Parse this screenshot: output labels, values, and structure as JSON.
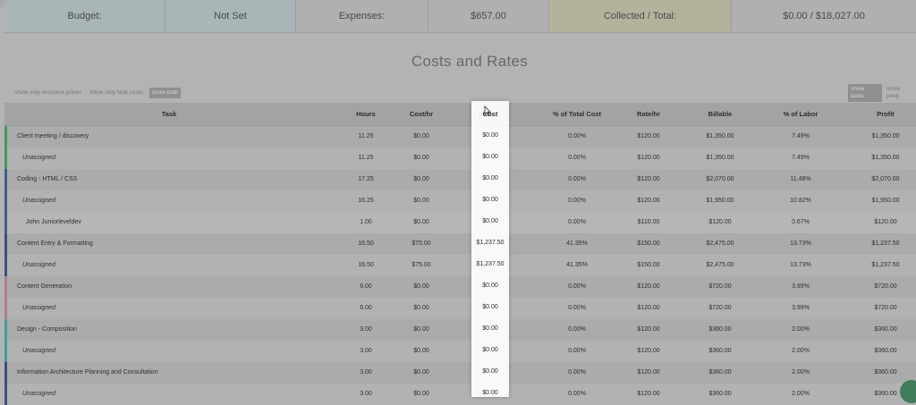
{
  "summary": {
    "budget_label": "Budget:",
    "budget_value": "Not Set",
    "expenses_label": "Expenses:",
    "expenses_value": "$657.00",
    "collected_label": "Collected / Total:",
    "collected_value": "$0.00 / $18,027.00"
  },
  "section_title": "Costs and Rates",
  "filters": {
    "resource_prices": "show only resource prices",
    "task_costs": "show only task costs",
    "both": "show both",
    "tasks": "show tasks",
    "people": "show peop"
  },
  "columns": {
    "task": "Task",
    "hours": "Hours",
    "cost_hr": "Cost/hr",
    "cost": "Cost",
    "pct_total_cost": "% of Total Cost",
    "rate_hr": "Rate/hr",
    "billable": "Billable",
    "pct_labor": "% of Labor",
    "profit": "Profit"
  },
  "rows": [
    {
      "task": "Client meeting / discovery",
      "hours": "11.25",
      "cost_hr": "$0.00",
      "cost": "$0.00",
      "pct_total_cost": "0.00%",
      "rate_hr": "$120.00",
      "billable": "$1,350.00",
      "pct_labor": "7.49%",
      "profit": "$1,350.00"
    },
    {
      "task": "Unassigned",
      "hours": "11.25",
      "cost_hr": "$0.00",
      "cost": "$0.00",
      "pct_total_cost": "0.00%",
      "rate_hr": "$120.00",
      "billable": "$1,350.00",
      "pct_labor": "7.49%",
      "profit": "$1,350.00"
    },
    {
      "task": "Coding - HTML / CSS",
      "hours": "17.25",
      "cost_hr": "$0.00",
      "cost": "$0.00",
      "pct_total_cost": "0.00%",
      "rate_hr": "$120.00",
      "billable": "$2,070.00",
      "pct_labor": "11.48%",
      "profit": "$2,070.00"
    },
    {
      "task": "Unassigned",
      "hours": "16.25",
      "cost_hr": "$0.00",
      "cost": "$0.00",
      "pct_total_cost": "0.00%",
      "rate_hr": "$120.00",
      "billable": "$1,950.00",
      "pct_labor": "10.82%",
      "profit": "$1,950.00"
    },
    {
      "task": "John Juniorleveldev",
      "hours": "1.00",
      "cost_hr": "$0.00",
      "cost": "$0.00",
      "pct_total_cost": "0.00%",
      "rate_hr": "$110.00",
      "billable": "$120.00",
      "pct_labor": "0.67%",
      "profit": "$120.00"
    },
    {
      "task": "Content Entry & Formatting",
      "hours": "16.50",
      "cost_hr": "$75.00",
      "cost": "$1,237.50",
      "pct_total_cost": "41.35%",
      "rate_hr": "$150.00",
      "billable": "$2,475.00",
      "pct_labor": "13.73%",
      "profit": "$1,237.50"
    },
    {
      "task": "Unassigned",
      "hours": "16.50",
      "cost_hr": "$75.00",
      "cost": "$1,237.50",
      "pct_total_cost": "41.35%",
      "rate_hr": "$150.00",
      "billable": "$2,475.00",
      "pct_labor": "13.73%",
      "profit": "$1,237.50"
    },
    {
      "task": "Content Generation",
      "hours": "6.00",
      "cost_hr": "$0.00",
      "cost": "$0.00",
      "pct_total_cost": "0.00%",
      "rate_hr": "$120.00",
      "billable": "$720.00",
      "pct_labor": "3.99%",
      "profit": "$720.00"
    },
    {
      "task": "Unassigned",
      "hours": "6.00",
      "cost_hr": "$0.00",
      "cost": "$0.00",
      "pct_total_cost": "0.00%",
      "rate_hr": "$120.00",
      "billable": "$720.00",
      "pct_labor": "3.99%",
      "profit": "$720.00"
    },
    {
      "task": "Design - Composition",
      "hours": "3.00",
      "cost_hr": "$0.00",
      "cost": "$0.00",
      "pct_total_cost": "0.00%",
      "rate_hr": "$120.00",
      "billable": "$360.00",
      "pct_labor": "2.00%",
      "profit": "$360.00"
    },
    {
      "task": "Unassigned",
      "hours": "3.00",
      "cost_hr": "$0.00",
      "cost": "$0.00",
      "pct_total_cost": "0.00%",
      "rate_hr": "$120.00",
      "billable": "$360.00",
      "pct_labor": "2.00%",
      "profit": "$360.00"
    },
    {
      "task": "Information Architecture Planning and Consultation",
      "hours": "3.00",
      "cost_hr": "$0.00",
      "cost": "$0.00",
      "pct_total_cost": "0.00%",
      "rate_hr": "$120.00",
      "billable": "$360.00",
      "pct_labor": "2.00%",
      "profit": "$360.00"
    },
    {
      "task": "Unassigned",
      "hours": "3.00",
      "cost_hr": "$0.00",
      "cost": "$0.00",
      "pct_total_cost": "0.00%",
      "rate_hr": "$120.00",
      "billable": "$360.00",
      "pct_labor": "2.00%",
      "profit": "$360.00"
    }
  ],
  "colors": {
    "stripe_green": "#3f9a5a",
    "stripe_blue": "#3f5e8a",
    "stripe_pink": "#b07e92",
    "stripe_teal": "#3aa19a",
    "stripe_navy": "#3c4f80"
  }
}
